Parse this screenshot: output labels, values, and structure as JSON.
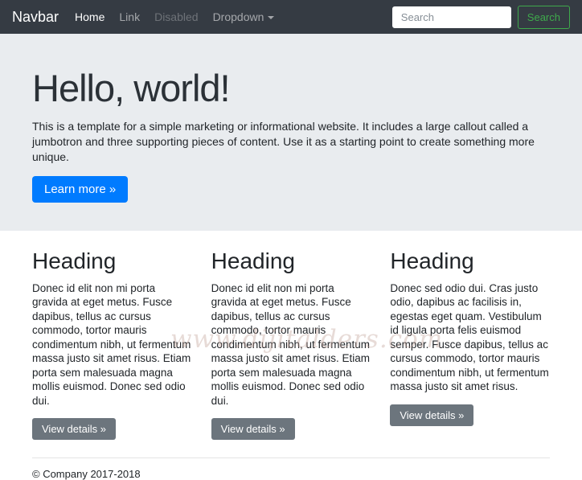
{
  "navbar": {
    "brand": "Navbar",
    "items": [
      {
        "label": "Home",
        "state": "active"
      },
      {
        "label": "Link",
        "state": "normal"
      },
      {
        "label": "Disabled",
        "state": "disabled"
      },
      {
        "label": "Dropdown",
        "state": "dropdown"
      }
    ],
    "search": {
      "placeholder": "Search",
      "button_label": "Search"
    }
  },
  "jumbotron": {
    "title": "Hello, world!",
    "description": "This is a template for a simple marketing or informational website. It includes a large callout called a jumbotron and three supporting pieces of content. Use it as a starting point to create something more unique.",
    "cta_label": "Learn more »"
  },
  "columns": [
    {
      "heading": "Heading",
      "text": "Donec id elit non mi porta gravida at eget metus. Fusce dapibus, tellus ac cursus commodo, tortor mauris condimentum nibh, ut fermentum massa justo sit amet risus. Etiam porta sem malesuada magna mollis euismod. Donec sed odio dui.",
      "button_label": "View details »"
    },
    {
      "heading": "Heading",
      "text": "Donec id elit non mi porta gravida at eget metus. Fusce dapibus, tellus ac cursus commodo, tortor mauris condimentum nibh, ut fermentum massa justo sit amet risus. Etiam porta sem malesuada magna mollis euismod. Donec sed odio dui.",
      "button_label": "View details »"
    },
    {
      "heading": "Heading",
      "text": "Donec sed odio dui. Cras justo odio, dapibus ac facilisis in, egestas eget quam. Vestibulum id ligula porta felis euismod semper. Fusce dapibus, tellus ac cursus commodo, tortor mauris condimentum nibh, ut fermentum massa justo sit amet risus.",
      "button_label": "View details »"
    }
  ],
  "footer": {
    "copyright": "© Company 2017-2018"
  },
  "watermark": {
    "text": "www.dijitalders.com"
  },
  "colors": {
    "navbar_bg": "#353b43",
    "jumbotron_bg": "#e9ecef",
    "primary_button": "#007bff",
    "secondary_button": "#6c757d",
    "search_button_green": "#3fa94c",
    "text": "#212529"
  }
}
